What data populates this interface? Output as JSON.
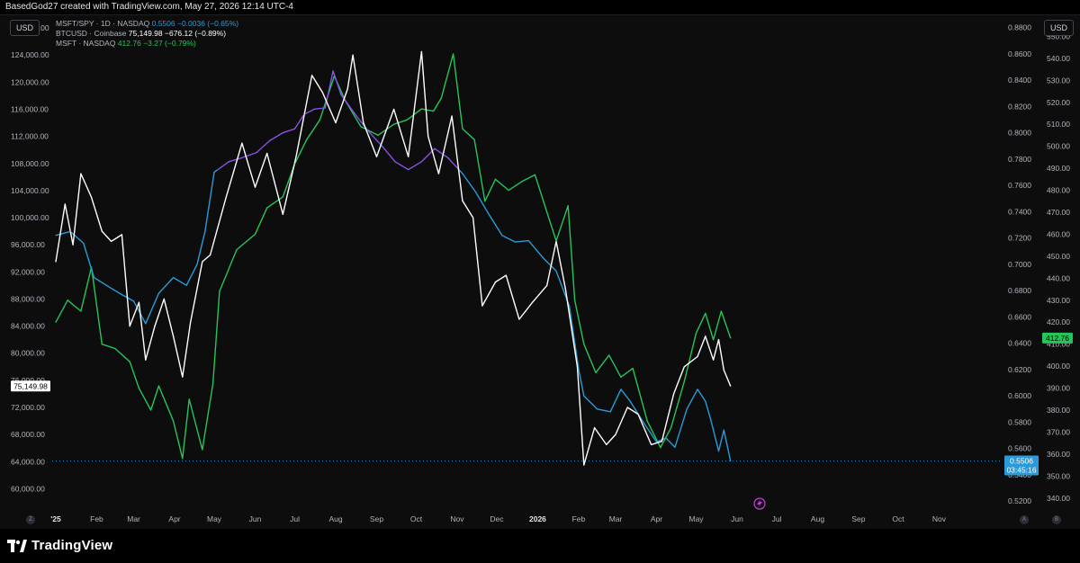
{
  "header": {
    "credit": "BasedGod27 created with TradingView.com, May 27, 2026 12:14 UTC-4"
  },
  "toolbar": {
    "left_currency": "USD",
    "right_currency": "USD"
  },
  "legend": [
    {
      "name": "MSFT/SPY · 1D · NASDAQ",
      "value": "0.5506",
      "change": "−0.0036 (−0.65%)",
      "color": "#2a9bd8"
    },
    {
      "name": "BTCUSD · Coinbase",
      "value": "75,149.98",
      "change": "−676.12 (−0.89%)",
      "color": "#ffffff"
    },
    {
      "name": "MSFT · NASDAQ",
      "value": "412.76",
      "change": "−3.27 (−0.79%)",
      "color": "#26c45a"
    }
  ],
  "footer": {
    "brand": "TradingView"
  },
  "corners": {
    "left": "Z",
    "right_top": "A",
    "right_bottom": "B"
  },
  "chart_data": {
    "type": "line",
    "x_axis": {
      "labels": [
        "'25",
        "Feb",
        "Mar",
        "Apr",
        "May",
        "Jun",
        "Jul",
        "Aug",
        "Sep",
        "Oct",
        "Nov",
        "Dec",
        "2026",
        "Feb",
        "Mar",
        "Apr",
        "May",
        "Jun",
        "Jul",
        "Aug",
        "Sep",
        "Oct",
        "Nov"
      ],
      "start": "2025-01-01",
      "end": "2026-11-30"
    },
    "left_axis": {
      "name": "BTCUSD",
      "range": [
        57000,
        130000
      ],
      "ticks": [
        60000,
        64000,
        68000,
        72000,
        76000,
        80000,
        84000,
        88000,
        92000,
        96000,
        100000,
        104000,
        108000,
        112000,
        116000,
        120000,
        124000,
        128000
      ],
      "tick_labels": [
        "60,000.00",
        "64,000.00",
        "68,000.00",
        "72,000.00",
        "76,000.00",
        "80,000.00",
        "84,000.00",
        "88,000.00",
        "92,000.00",
        "96,000.00",
        "100,000.00",
        "104,000.00",
        "108,000.00",
        "112,000.00",
        "116,000.00",
        "120,000.00",
        "124,000.00",
        "128,000.00"
      ],
      "last_value_label": "75,149.98"
    },
    "right_axis_ratio": {
      "name": "MSFT/SPY",
      "range": [
        0.514,
        0.89
      ],
      "ticks": [
        0.52,
        0.54,
        0.56,
        0.58,
        0.6,
        0.62,
        0.64,
        0.66,
        0.68,
        0.7,
        0.72,
        0.74,
        0.76,
        0.78,
        0.8,
        0.82,
        0.84,
        0.86,
        0.88
      ],
      "tick_labels": [
        "0.5200",
        "0.5400",
        "0.5600",
        "0.5800",
        "0.6000",
        "0.6200",
        "0.6400",
        "0.6600",
        "0.6800",
        "0.7000",
        "0.7200",
        "0.7400",
        "0.7600",
        "0.7800",
        "0.8000",
        "0.8200",
        "0.8400",
        "0.8600",
        "0.8800"
      ],
      "last_value_label": "0.5506",
      "countdown": "03:45:16"
    },
    "right_axis_price": {
      "name": "MSFT",
      "range": [
        335,
        560
      ],
      "ticks": [
        340,
        350,
        360,
        370,
        380,
        390,
        400,
        410,
        420,
        430,
        440,
        450,
        460,
        470,
        480,
        490,
        500,
        510,
        520,
        530,
        540,
        550
      ],
      "tick_labels": [
        "340.00",
        "350.00",
        "360.00",
        "370.00",
        "380.00",
        "390.00",
        "400.00",
        "410.00",
        "420.00",
        "430.00",
        "440.00",
        "450.00",
        "460.00",
        "470.00",
        "480.00",
        "490.00",
        "500.00",
        "510.00",
        "520.00",
        "530.00",
        "540.00",
        "550.00"
      ],
      "last_value_label": "412.76"
    },
    "series": [
      {
        "name": "MSFT/SPY",
        "axis": "ratio",
        "color_above": "#8b4fe8",
        "color_below": "#2a9bd8",
        "points": [
          [
            "2025-01-01",
            0.722
          ],
          [
            "2025-01-12",
            0.725
          ],
          [
            "2025-01-22",
            0.716
          ],
          [
            "2025-01-30",
            0.69
          ],
          [
            "2025-02-10",
            0.683
          ],
          [
            "2025-02-20",
            0.677
          ],
          [
            "2025-03-01",
            0.672
          ],
          [
            "2025-03-10",
            0.655
          ],
          [
            "2025-03-20",
            0.678
          ],
          [
            "2025-03-31",
            0.69
          ],
          [
            "2025-04-10",
            0.684
          ],
          [
            "2025-04-18",
            0.7
          ],
          [
            "2025-04-24",
            0.725
          ],
          [
            "2025-05-01",
            0.77
          ],
          [
            "2025-05-12",
            0.778
          ],
          [
            "2025-05-22",
            0.781
          ],
          [
            "2025-06-02",
            0.785
          ],
          [
            "2025-06-12",
            0.794
          ],
          [
            "2025-06-22",
            0.8
          ],
          [
            "2025-07-01",
            0.803
          ],
          [
            "2025-07-08",
            0.814
          ],
          [
            "2025-07-16",
            0.818
          ],
          [
            "2025-07-24",
            0.819
          ],
          [
            "2025-07-30",
            0.847
          ],
          [
            "2025-08-05",
            0.829
          ],
          [
            "2025-08-15",
            0.815
          ],
          [
            "2025-08-25",
            0.802
          ],
          [
            "2025-09-05",
            0.79
          ],
          [
            "2025-09-15",
            0.778
          ],
          [
            "2025-09-25",
            0.772
          ],
          [
            "2025-10-05",
            0.778
          ],
          [
            "2025-10-15",
            0.788
          ],
          [
            "2025-10-25",
            0.781
          ],
          [
            "2025-11-05",
            0.769
          ],
          [
            "2025-11-15",
            0.755
          ],
          [
            "2025-11-25",
            0.738
          ],
          [
            "2025-12-05",
            0.722
          ],
          [
            "2025-12-15",
            0.717
          ],
          [
            "2025-12-25",
            0.718
          ],
          [
            "2026-01-05",
            0.705
          ],
          [
            "2026-01-15",
            0.695
          ],
          [
            "2026-01-25",
            0.668
          ],
          [
            "2026-02-01",
            0.62
          ],
          [
            "2026-02-05",
            0.6
          ],
          [
            "2026-02-15",
            0.59
          ],
          [
            "2026-02-25",
            0.588
          ],
          [
            "2026-03-05",
            0.605
          ],
          [
            "2026-03-12",
            0.596
          ],
          [
            "2026-03-22",
            0.58
          ],
          [
            "2026-04-01",
            0.565
          ],
          [
            "2026-04-08",
            0.568
          ],
          [
            "2026-04-15",
            0.561
          ],
          [
            "2026-04-24",
            0.59
          ],
          [
            "2026-05-02",
            0.605
          ],
          [
            "2026-05-08",
            0.596
          ],
          [
            "2026-05-12",
            0.582
          ],
          [
            "2026-05-18",
            0.558
          ],
          [
            "2026-05-22",
            0.574
          ],
          [
            "2026-05-27",
            0.5506
          ]
        ]
      },
      {
        "name": "BTCUSD",
        "axis": "left",
        "color": "#ffffff",
        "points": [
          [
            "2025-01-01",
            93500
          ],
          [
            "2025-01-08",
            102000
          ],
          [
            "2025-01-14",
            96000
          ],
          [
            "2025-01-20",
            106500
          ],
          [
            "2025-01-28",
            103000
          ],
          [
            "2025-02-05",
            98000
          ],
          [
            "2025-02-12",
            96500
          ],
          [
            "2025-02-20",
            97500
          ],
          [
            "2025-02-26",
            84000
          ],
          [
            "2025-03-05",
            87500
          ],
          [
            "2025-03-10",
            79000
          ],
          [
            "2025-03-17",
            84000
          ],
          [
            "2025-03-24",
            88000
          ],
          [
            "2025-03-31",
            82500
          ],
          [
            "2025-04-07",
            76500
          ],
          [
            "2025-04-13",
            84500
          ],
          [
            "2025-04-22",
            93500
          ],
          [
            "2025-04-28",
            94500
          ],
          [
            "2025-05-10",
            103000
          ],
          [
            "2025-05-22",
            111000
          ],
          [
            "2025-06-01",
            104500
          ],
          [
            "2025-06-10",
            109500
          ],
          [
            "2025-06-22",
            100500
          ],
          [
            "2025-07-02",
            109000
          ],
          [
            "2025-07-14",
            121000
          ],
          [
            "2025-07-22",
            118500
          ],
          [
            "2025-08-01",
            114000
          ],
          [
            "2025-08-10",
            119000
          ],
          [
            "2025-08-14",
            124000
          ],
          [
            "2025-08-22",
            114000
          ],
          [
            "2025-09-01",
            109000
          ],
          [
            "2025-09-14",
            116000
          ],
          [
            "2025-09-25",
            109000
          ],
          [
            "2025-10-05",
            124500
          ],
          [
            "2025-10-10",
            112000
          ],
          [
            "2025-10-18",
            106500
          ],
          [
            "2025-10-28",
            115000
          ],
          [
            "2025-11-05",
            102500
          ],
          [
            "2025-11-13",
            100000
          ],
          [
            "2025-11-20",
            87000
          ],
          [
            "2025-11-30",
            90500
          ],
          [
            "2025-12-08",
            91500
          ],
          [
            "2025-12-18",
            85000
          ],
          [
            "2025-12-28",
            87500
          ],
          [
            "2026-01-08",
            90000
          ],
          [
            "2026-01-15",
            96500
          ],
          [
            "2026-01-22",
            89500
          ],
          [
            "2026-01-31",
            78000
          ],
          [
            "2026-02-05",
            63500
          ],
          [
            "2026-02-13",
            69000
          ],
          [
            "2026-02-22",
            66500
          ],
          [
            "2026-03-01",
            68000
          ],
          [
            "2026-03-10",
            72000
          ],
          [
            "2026-03-18",
            71000
          ],
          [
            "2026-03-28",
            66500
          ],
          [
            "2026-04-05",
            67000
          ],
          [
            "2026-04-14",
            74000
          ],
          [
            "2026-04-22",
            78000
          ],
          [
            "2026-05-02",
            79500
          ],
          [
            "2026-05-08",
            82500
          ],
          [
            "2026-05-14",
            79000
          ],
          [
            "2026-05-18",
            82000
          ],
          [
            "2026-05-22",
            77500
          ],
          [
            "2026-05-27",
            75150
          ]
        ]
      },
      {
        "name": "MSFT",
        "axis": "price",
        "color": "#26c45a",
        "points": [
          [
            "2025-01-01",
            420
          ],
          [
            "2025-01-10",
            430
          ],
          [
            "2025-01-20",
            425
          ],
          [
            "2025-01-28",
            445
          ],
          [
            "2025-02-05",
            410
          ],
          [
            "2025-02-15",
            408
          ],
          [
            "2025-02-26",
            402
          ],
          [
            "2025-03-05",
            390
          ],
          [
            "2025-03-14",
            380
          ],
          [
            "2025-03-20",
            391
          ],
          [
            "2025-03-31",
            375
          ],
          [
            "2025-04-07",
            358
          ],
          [
            "2025-04-12",
            385
          ],
          [
            "2025-04-22",
            362
          ],
          [
            "2025-04-30",
            392
          ],
          [
            "2025-05-05",
            434
          ],
          [
            "2025-05-18",
            453
          ],
          [
            "2025-06-01",
            460
          ],
          [
            "2025-06-10",
            472
          ],
          [
            "2025-06-22",
            477
          ],
          [
            "2025-07-01",
            492
          ],
          [
            "2025-07-10",
            503
          ],
          [
            "2025-07-20",
            512
          ],
          [
            "2025-07-31",
            532
          ],
          [
            "2025-08-08",
            521
          ],
          [
            "2025-08-20",
            509
          ],
          [
            "2025-09-02",
            505
          ],
          [
            "2025-09-14",
            510
          ],
          [
            "2025-09-24",
            512
          ],
          [
            "2025-10-05",
            517
          ],
          [
            "2025-10-14",
            516
          ],
          [
            "2025-10-20",
            522
          ],
          [
            "2025-10-29",
            542
          ],
          [
            "2025-11-05",
            508
          ],
          [
            "2025-11-14",
            503
          ],
          [
            "2025-11-22",
            475
          ],
          [
            "2025-11-30",
            485
          ],
          [
            "2025-12-10",
            480
          ],
          [
            "2025-12-20",
            484
          ],
          [
            "2025-12-30",
            487
          ],
          [
            "2026-01-08",
            470
          ],
          [
            "2026-01-15",
            457
          ],
          [
            "2026-01-24",
            473
          ],
          [
            "2026-01-29",
            430
          ],
          [
            "2026-02-05",
            410
          ],
          [
            "2026-02-14",
            397
          ],
          [
            "2026-02-24",
            405
          ],
          [
            "2026-03-05",
            395
          ],
          [
            "2026-03-14",
            399
          ],
          [
            "2026-03-25",
            375
          ],
          [
            "2026-04-04",
            363
          ],
          [
            "2026-04-12",
            372
          ],
          [
            "2026-04-22",
            393
          ],
          [
            "2026-05-01",
            415
          ],
          [
            "2026-05-08",
            424
          ],
          [
            "2026-05-14",
            412
          ],
          [
            "2026-05-20",
            425
          ],
          [
            "2026-05-27",
            412.76
          ]
        ]
      }
    ],
    "grid": false
  }
}
